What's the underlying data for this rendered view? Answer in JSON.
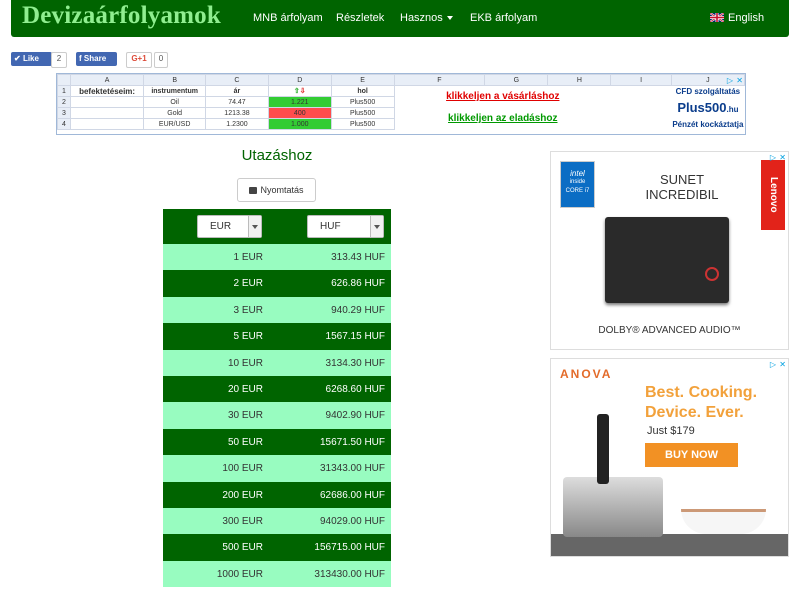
{
  "brand": "Devizaárfolyamok",
  "nav": {
    "items": [
      "MNB árfolyam",
      "Részletek",
      "Hasznos",
      "EKB árfolyam"
    ],
    "language": "English"
  },
  "social": {
    "like_label": "Like",
    "like_count": "2",
    "share_label": "Share",
    "gplus_label": "G+1",
    "gplus_count": "0"
  },
  "sheet_ad": {
    "columns": [
      "A",
      "B",
      "C",
      "D",
      "E",
      "F",
      "G",
      "H",
      "I",
      "J"
    ],
    "row_numbers": [
      "1",
      "2",
      "3",
      "4"
    ],
    "headers": [
      "befektetéseim:",
      "instrumentum",
      "ár",
      "",
      "hol"
    ],
    "rows": [
      [
        "",
        "Oil",
        "74.47",
        "1.221",
        "Plus500"
      ],
      [
        "",
        "Gold",
        "1213.38",
        "400",
        "Plus500"
      ],
      [
        "",
        "EUR/USD",
        "1.2300",
        "1.000",
        "Plus500"
      ]
    ],
    "buy_text": "klikkeljen a vásárláshoz",
    "sell_text": "klikkeljen az eladáshoz",
    "cfd_text": "CFD szolgáltatás",
    "plus500_logo": "Plus500",
    "plus500_suffix": ".hu",
    "risk_text": "Pénzét kockáztatja"
  },
  "page": {
    "title": "Utazáshoz",
    "print_label": "Nyomtatás"
  },
  "converter": {
    "from_currency": "EUR",
    "to_currency": "HUF",
    "rows": [
      {
        "from": "1 EUR",
        "to": "313.43 HUF"
      },
      {
        "from": "2 EUR",
        "to": "626.86 HUF"
      },
      {
        "from": "3 EUR",
        "to": "940.29 HUF"
      },
      {
        "from": "5 EUR",
        "to": "1567.15 HUF"
      },
      {
        "from": "10 EUR",
        "to": "3134.30 HUF"
      },
      {
        "from": "20 EUR",
        "to": "6268.60 HUF"
      },
      {
        "from": "30 EUR",
        "to": "9402.90 HUF"
      },
      {
        "from": "50 EUR",
        "to": "15671.50 HUF"
      },
      {
        "from": "100 EUR",
        "to": "31343.00 HUF"
      },
      {
        "from": "200 EUR",
        "to": "62686.00 HUF"
      },
      {
        "from": "300 EUR",
        "to": "94029.00 HUF"
      },
      {
        "from": "500 EUR",
        "to": "156715.00 HUF"
      },
      {
        "from": "1000 EUR",
        "to": "313430.00 HUF"
      }
    ]
  },
  "ad_lenovo": {
    "intel_line1": "intel",
    "intel_line2": "inside",
    "intel_line3": "CORE i7",
    "brand": "Lenovo",
    "headline_1": "SUNET",
    "headline_2": "INCREDIBIL",
    "footer": "DOLBY® ADVANCED AUDIO™"
  },
  "ad_anova": {
    "brand": "ANOVA",
    "headline_1": "Best. Cooking.",
    "headline_2": "Device. Ever.",
    "price": "Just $179",
    "cta": "BUY NOW"
  },
  "colors": {
    "nav_bg": "#006400",
    "brand": "#90ee90",
    "row_light": "#98fcc0",
    "row_dark": "#006400"
  }
}
